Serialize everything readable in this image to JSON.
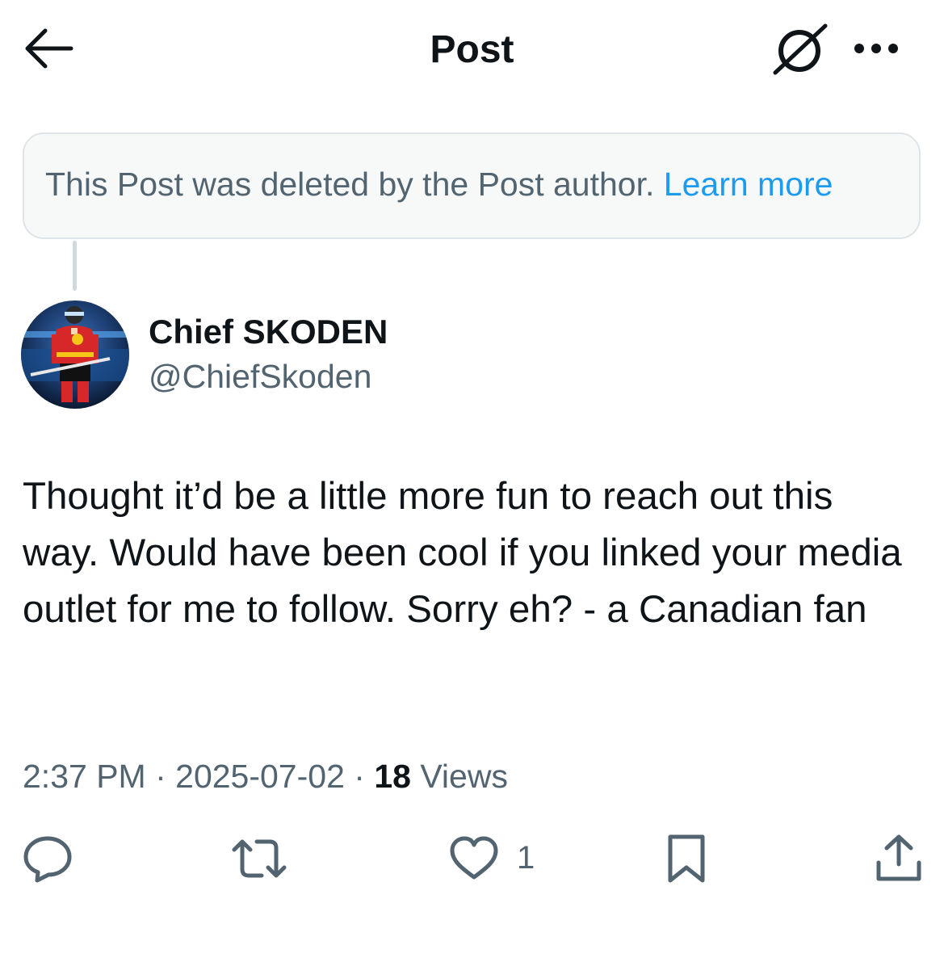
{
  "header": {
    "title": "Post",
    "back_icon": "arrow-left-icon",
    "grok_icon": "grok-icon",
    "more_icon": "more-horizontal-icon"
  },
  "deleted_notice": {
    "text": "This Post was deleted by the Post author.",
    "link": "Learn more"
  },
  "author": {
    "name": "Chief SKODEN",
    "handle": "@ChiefSkoden",
    "avatar_icon": "hockey-player-avatar"
  },
  "post": {
    "text": "Thought it’d be a little more fun to reach out this way. Would have been cool if you linked your media outlet for me to follow. Sorry eh? - a Canadian fan"
  },
  "meta": {
    "time": "2:37 PM",
    "sep1": " · ",
    "date": "2025-07-02",
    "sep2": " · ",
    "views_count": "18",
    "views_label": " Views"
  },
  "actions": {
    "reply_icon": "reply-icon",
    "repost_icon": "repost-icon",
    "like_icon": "heart-icon",
    "like_count": "1",
    "bookmark_icon": "bookmark-icon",
    "share_icon": "share-icon"
  },
  "colors": {
    "link": "#1d9bf0",
    "secondary_text": "#536471",
    "primary_text": "#0f1419"
  }
}
